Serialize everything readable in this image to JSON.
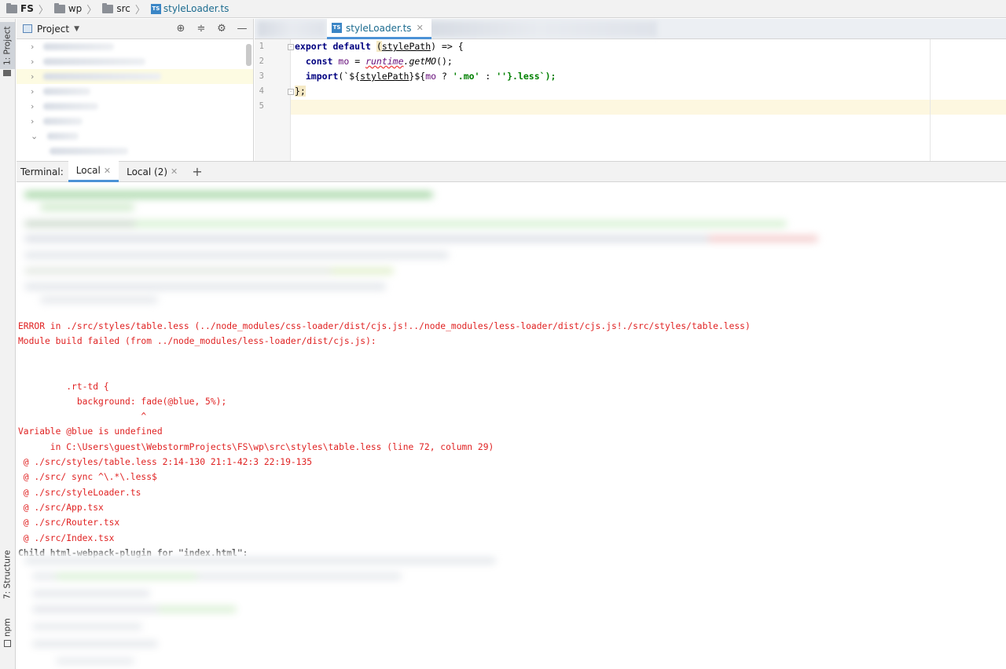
{
  "breadcrumb": {
    "items": [
      "FS",
      "wp",
      "src"
    ],
    "file": "styleLoader.ts",
    "file_icon": "TS"
  },
  "left_stripe": {
    "project_tab": "1: Project",
    "structure_tab": "7: Structure",
    "npm_tab": "npm"
  },
  "project_panel": {
    "title": "Project"
  },
  "editor": {
    "tab_label": "styleLoader.ts",
    "tab_icon": "TS",
    "line_numbers": [
      "1",
      "2",
      "3",
      "4",
      "5"
    ],
    "code": {
      "l1_kw1": "export",
      "l1_kw2": "default",
      "l1_open": "(",
      "l1_param": "stylePath",
      "l1_close": ") => {",
      "l2_kw": "const",
      "l2_var": "mo",
      "l2_eq": " = ",
      "l2_obj": "runtime",
      "l2_call": ".getMO",
      "l2_end": "();",
      "l3_kw": "import",
      "l3_a": "(`${",
      "l3_param": "stylePath",
      "l3_b": "}${",
      "l3_var": "mo",
      "l3_c": " ? ",
      "l3_str1": "'.mo'",
      "l3_d": " : ",
      "l3_str2": "''",
      "l3_e": "}.less`);",
      "l4": "};"
    }
  },
  "terminal": {
    "label": "Terminal:",
    "tabs": [
      "Local",
      "Local (2)"
    ],
    "add_label": "+",
    "output": [
      "ERROR in ./src/styles/table.less (../node_modules/css-loader/dist/cjs.js!../node_modules/less-loader/dist/cjs.js!./src/styles/table.less)",
      "Module build failed (from ../node_modules/less-loader/dist/cjs.js):",
      "",
      "",
      "         .rt-td {",
      "           background: fade(@blue, 5%);",
      "                       ^",
      "Variable @blue is undefined",
      "      in C:\\Users\\guest\\WebstormProjects\\FS\\wp\\src\\styles\\table.less (line 72, column 29)",
      " @ ./src/styles/table.less 2:14-130 21:1-42:3 22:19-135",
      " @ ./src/ sync ^\\.*\\.less$",
      " @ ./src/styleLoader.ts",
      " @ ./src/App.tsx",
      " @ ./src/Router.tsx",
      " @ ./src/Index.tsx",
      "Child html-webpack-plugin for \"index.html\":"
    ]
  },
  "colors": {
    "error_red": "#e02222",
    "accent_blue": "#4b92d6",
    "caret_line": "#fdf7e0",
    "keyword_navy": "#000080"
  }
}
